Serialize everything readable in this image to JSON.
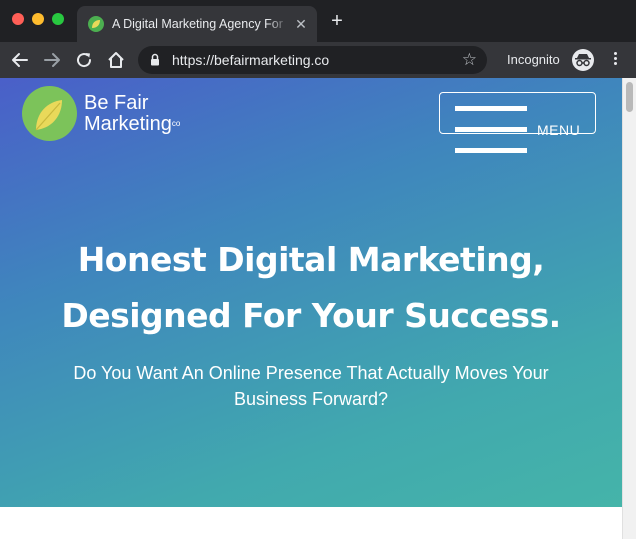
{
  "browser": {
    "tab": {
      "title": "A Digital Marketing Agency For",
      "close_glyph": "✕"
    },
    "new_tab_glyph": "+",
    "address": {
      "url": "https://befairmarketing.co"
    },
    "star_glyph": "☆",
    "incognito_label": "Incognito",
    "icons": [
      "back-arrow-icon",
      "forward-arrow-icon",
      "reload-icon",
      "home-icon",
      "lock-icon",
      "star-icon",
      "incognito-icon",
      "more-menu-icon"
    ]
  },
  "site": {
    "logo": {
      "line1": "Be Fair",
      "line2": "Marketing",
      "suffix": "co"
    },
    "menu_label": "MENU",
    "hero": {
      "headline_line1": "Honest Digital Marketing,",
      "headline_line2": "Designed For Your Success.",
      "subheadline_line1": "Do You Want An Online Presence That Actually Moves Your",
      "subheadline_line2": "Business Forward?"
    }
  },
  "colors": {
    "hero_gradient_start": "#4a5fc9",
    "hero_gradient_end": "#45b4a9",
    "logo_green": "#7cc35a",
    "leaf_yellow": "#e9d95a"
  }
}
